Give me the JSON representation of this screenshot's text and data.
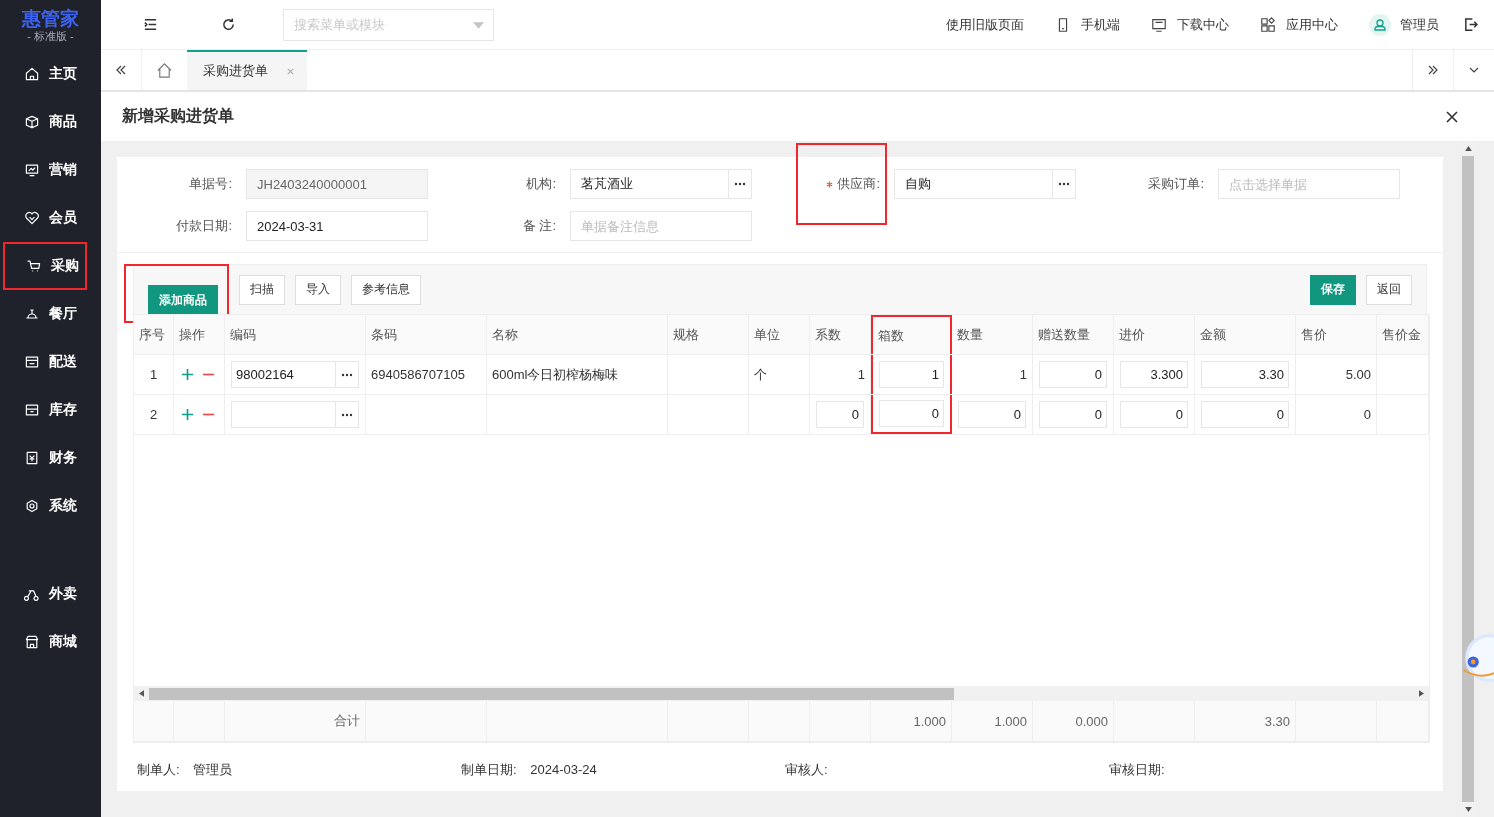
{
  "sidebar": {
    "logo": "惠管家",
    "edition": "- 标准版 -",
    "items": [
      {
        "label": "主页",
        "highlighted": false
      },
      {
        "label": "商品",
        "highlighted": false
      },
      {
        "label": "营销",
        "highlighted": false
      },
      {
        "label": "会员",
        "highlighted": false
      },
      {
        "label": "采购",
        "highlighted": true
      },
      {
        "label": "餐厅",
        "highlighted": false
      },
      {
        "label": "配送",
        "highlighted": false
      },
      {
        "label": "库存",
        "highlighted": false
      },
      {
        "label": "财务",
        "highlighted": false
      },
      {
        "label": "系统",
        "highlighted": false
      }
    ],
    "bottom_items": [
      {
        "label": "外卖",
        "highlighted": false
      },
      {
        "label": "商城",
        "highlighted": false
      }
    ]
  },
  "topbar": {
    "search": {
      "placeholder": "搜索菜单或模块"
    },
    "links": [
      {
        "label": "使用旧版页面"
      },
      {
        "label": "手机端"
      },
      {
        "label": "下载中心"
      },
      {
        "label": "应用中心"
      }
    ],
    "user": "管理员"
  },
  "tabs": [
    {
      "label": "采购进货单",
      "selected": true
    }
  ],
  "dialog": {
    "title": "新增采购进货单"
  },
  "form": {
    "fields": [
      {
        "label": "单据号:",
        "kind": "readonly",
        "value": "JH2403240000001",
        "required": false,
        "highlighted": false
      },
      {
        "label": "机构:",
        "kind": "picker",
        "value": "茗芃酒业",
        "required": false,
        "highlighted": false
      },
      {
        "label": "供应商:",
        "kind": "picker",
        "value": "自购",
        "required": true,
        "highlighted": true
      },
      {
        "label": "采购订单:",
        "kind": "text",
        "placeholder": "点击选择单据",
        "required": false,
        "highlighted": false
      },
      {
        "label": "付款日期:",
        "kind": "text",
        "value": "2024-03-31",
        "required": false,
        "highlighted": false
      },
      {
        "label": "备 注:",
        "kind": "text",
        "placeholder": "单据备注信息",
        "required": false,
        "highlighted": false
      }
    ]
  },
  "toolbar": {
    "left_buttons": [
      {
        "label": "添加商品",
        "kind": "primary",
        "highlighted": true
      },
      {
        "label": "扫描",
        "kind": "default",
        "highlighted": false
      },
      {
        "label": "导入",
        "kind": "default",
        "highlighted": false
      },
      {
        "label": "参考信息",
        "kind": "default",
        "highlighted": false
      }
    ],
    "right_buttons": [
      {
        "label": "保存",
        "kind": "primary",
        "highlighted": false
      },
      {
        "label": "返回",
        "kind": "default",
        "highlighted": false
      }
    ]
  },
  "table": {
    "columns": [
      {
        "label": "序号",
        "highlighted": false
      },
      {
        "label": "操作",
        "highlighted": false
      },
      {
        "label": "编码",
        "highlighted": false
      },
      {
        "label": "条码",
        "highlighted": false
      },
      {
        "label": "名称",
        "highlighted": false
      },
      {
        "label": "规格",
        "highlighted": false
      },
      {
        "label": "单位",
        "highlighted": false
      },
      {
        "label": "系数",
        "highlighted": false
      },
      {
        "label": "箱数",
        "highlighted": true
      },
      {
        "label": "数量",
        "highlighted": false
      },
      {
        "label": "赠送数量",
        "highlighted": false
      },
      {
        "label": "进价",
        "highlighted": false
      },
      {
        "label": "金额",
        "highlighted": false
      },
      {
        "label": "售价",
        "highlighted": false
      },
      {
        "label": "售价金",
        "highlighted": false
      }
    ],
    "rows": [
      {
        "cells": [
          {
            "kind": "index",
            "value": "1"
          },
          {
            "kind": "ops"
          },
          {
            "kind": "picker",
            "value": "98002164"
          },
          {
            "kind": "text",
            "value": "6940586707105"
          },
          {
            "kind": "text",
            "value": "600ml今日初榨杨梅味"
          },
          {
            "kind": "blank"
          },
          {
            "kind": "text",
            "value": "个"
          },
          {
            "kind": "number",
            "value": "1"
          },
          {
            "kind": "input",
            "value": "1"
          },
          {
            "kind": "number",
            "value": "1"
          },
          {
            "kind": "input",
            "value": "0"
          },
          {
            "kind": "input",
            "value": "3.300"
          },
          {
            "kind": "input",
            "value": "3.30"
          },
          {
            "kind": "number",
            "value": "5.00"
          },
          {
            "kind": "blank"
          }
        ]
      },
      {
        "cells": [
          {
            "kind": "index",
            "value": "2"
          },
          {
            "kind": "ops"
          },
          {
            "kind": "picker"
          },
          {
            "kind": "blank"
          },
          {
            "kind": "blank"
          },
          {
            "kind": "blank"
          },
          {
            "kind": "blank"
          },
          {
            "kind": "input",
            "value": "0"
          },
          {
            "kind": "input",
            "value": "0"
          },
          {
            "kind": "input",
            "value": "0"
          },
          {
            "kind": "input",
            "value": "0"
          },
          {
            "kind": "input",
            "value": "0"
          },
          {
            "kind": "input",
            "value": "0"
          },
          {
            "kind": "number",
            "value": "0"
          },
          {
            "kind": "blank"
          }
        ]
      }
    ],
    "totals": [
      {
        "kind": "blank"
      },
      {
        "kind": "blank"
      },
      {
        "kind": "text",
        "value": "合计"
      },
      {
        "kind": "blank"
      },
      {
        "kind": "blank"
      },
      {
        "kind": "blank"
      },
      {
        "kind": "blank"
      },
      {
        "kind": "blank"
      },
      {
        "kind": "text",
        "value": "1.000"
      },
      {
        "kind": "text",
        "value": "1.000"
      },
      {
        "kind": "text",
        "value": "0.000"
      },
      {
        "kind": "blank"
      },
      {
        "kind": "text",
        "value": "3.30"
      },
      {
        "kind": "blank"
      },
      {
        "kind": "blank"
      }
    ]
  },
  "footer": [
    {
      "label": "制单人:",
      "value": "管理员"
    },
    {
      "label": "制单日期:",
      "value": "2024-03-24"
    },
    {
      "label": "审核人:"
    },
    {
      "label": "审核日期:"
    }
  ]
}
